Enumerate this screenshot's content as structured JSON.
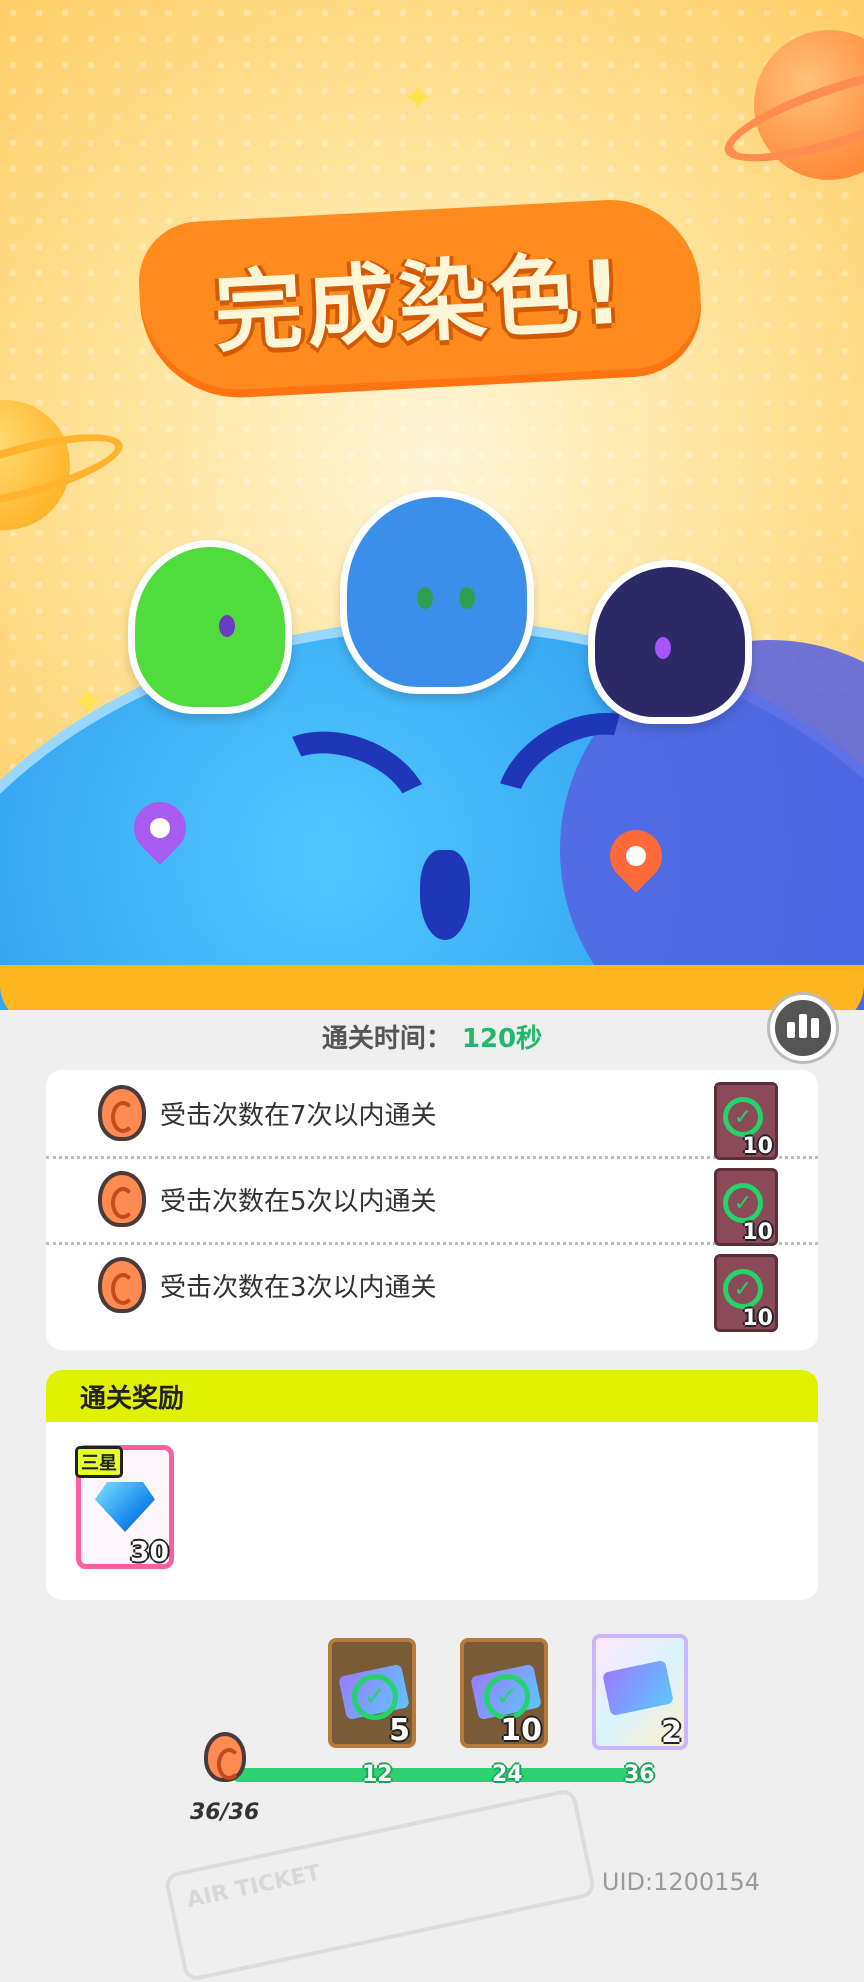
{
  "result": {
    "title": "完成染色!",
    "clear_time_label": "通关时间：",
    "clear_time_value": "120秒"
  },
  "tasks": [
    {
      "text": "受击次数在7次以内通关",
      "reward_count": "10",
      "completed": true
    },
    {
      "text": "受击次数在5次以内通关",
      "reward_count": "10",
      "completed": true
    },
    {
      "text": "受击次数在3次以内通关",
      "reward_count": "10",
      "completed": true
    }
  ],
  "rewards": {
    "header": "通关奖励",
    "items": [
      {
        "tag": "三星",
        "icon": "diamond-icon",
        "count": "30"
      }
    ]
  },
  "progress": {
    "current": "36/36",
    "fraction": 1.0,
    "milestones": [
      {
        "threshold": "12",
        "reward_count": "5",
        "claimed": true
      },
      {
        "threshold": "24",
        "reward_count": "10",
        "claimed": true
      },
      {
        "threshold": "36",
        "reward_count": "2",
        "claimed": false
      }
    ]
  },
  "background_ticket_text": "AIR TICKET",
  "uid": "UID:1200154",
  "colors": {
    "accent_orange": "#ff8a1d",
    "success_green": "#2ed06f",
    "reward_header": "#dff200",
    "reward_border": "#ff5fa0"
  }
}
